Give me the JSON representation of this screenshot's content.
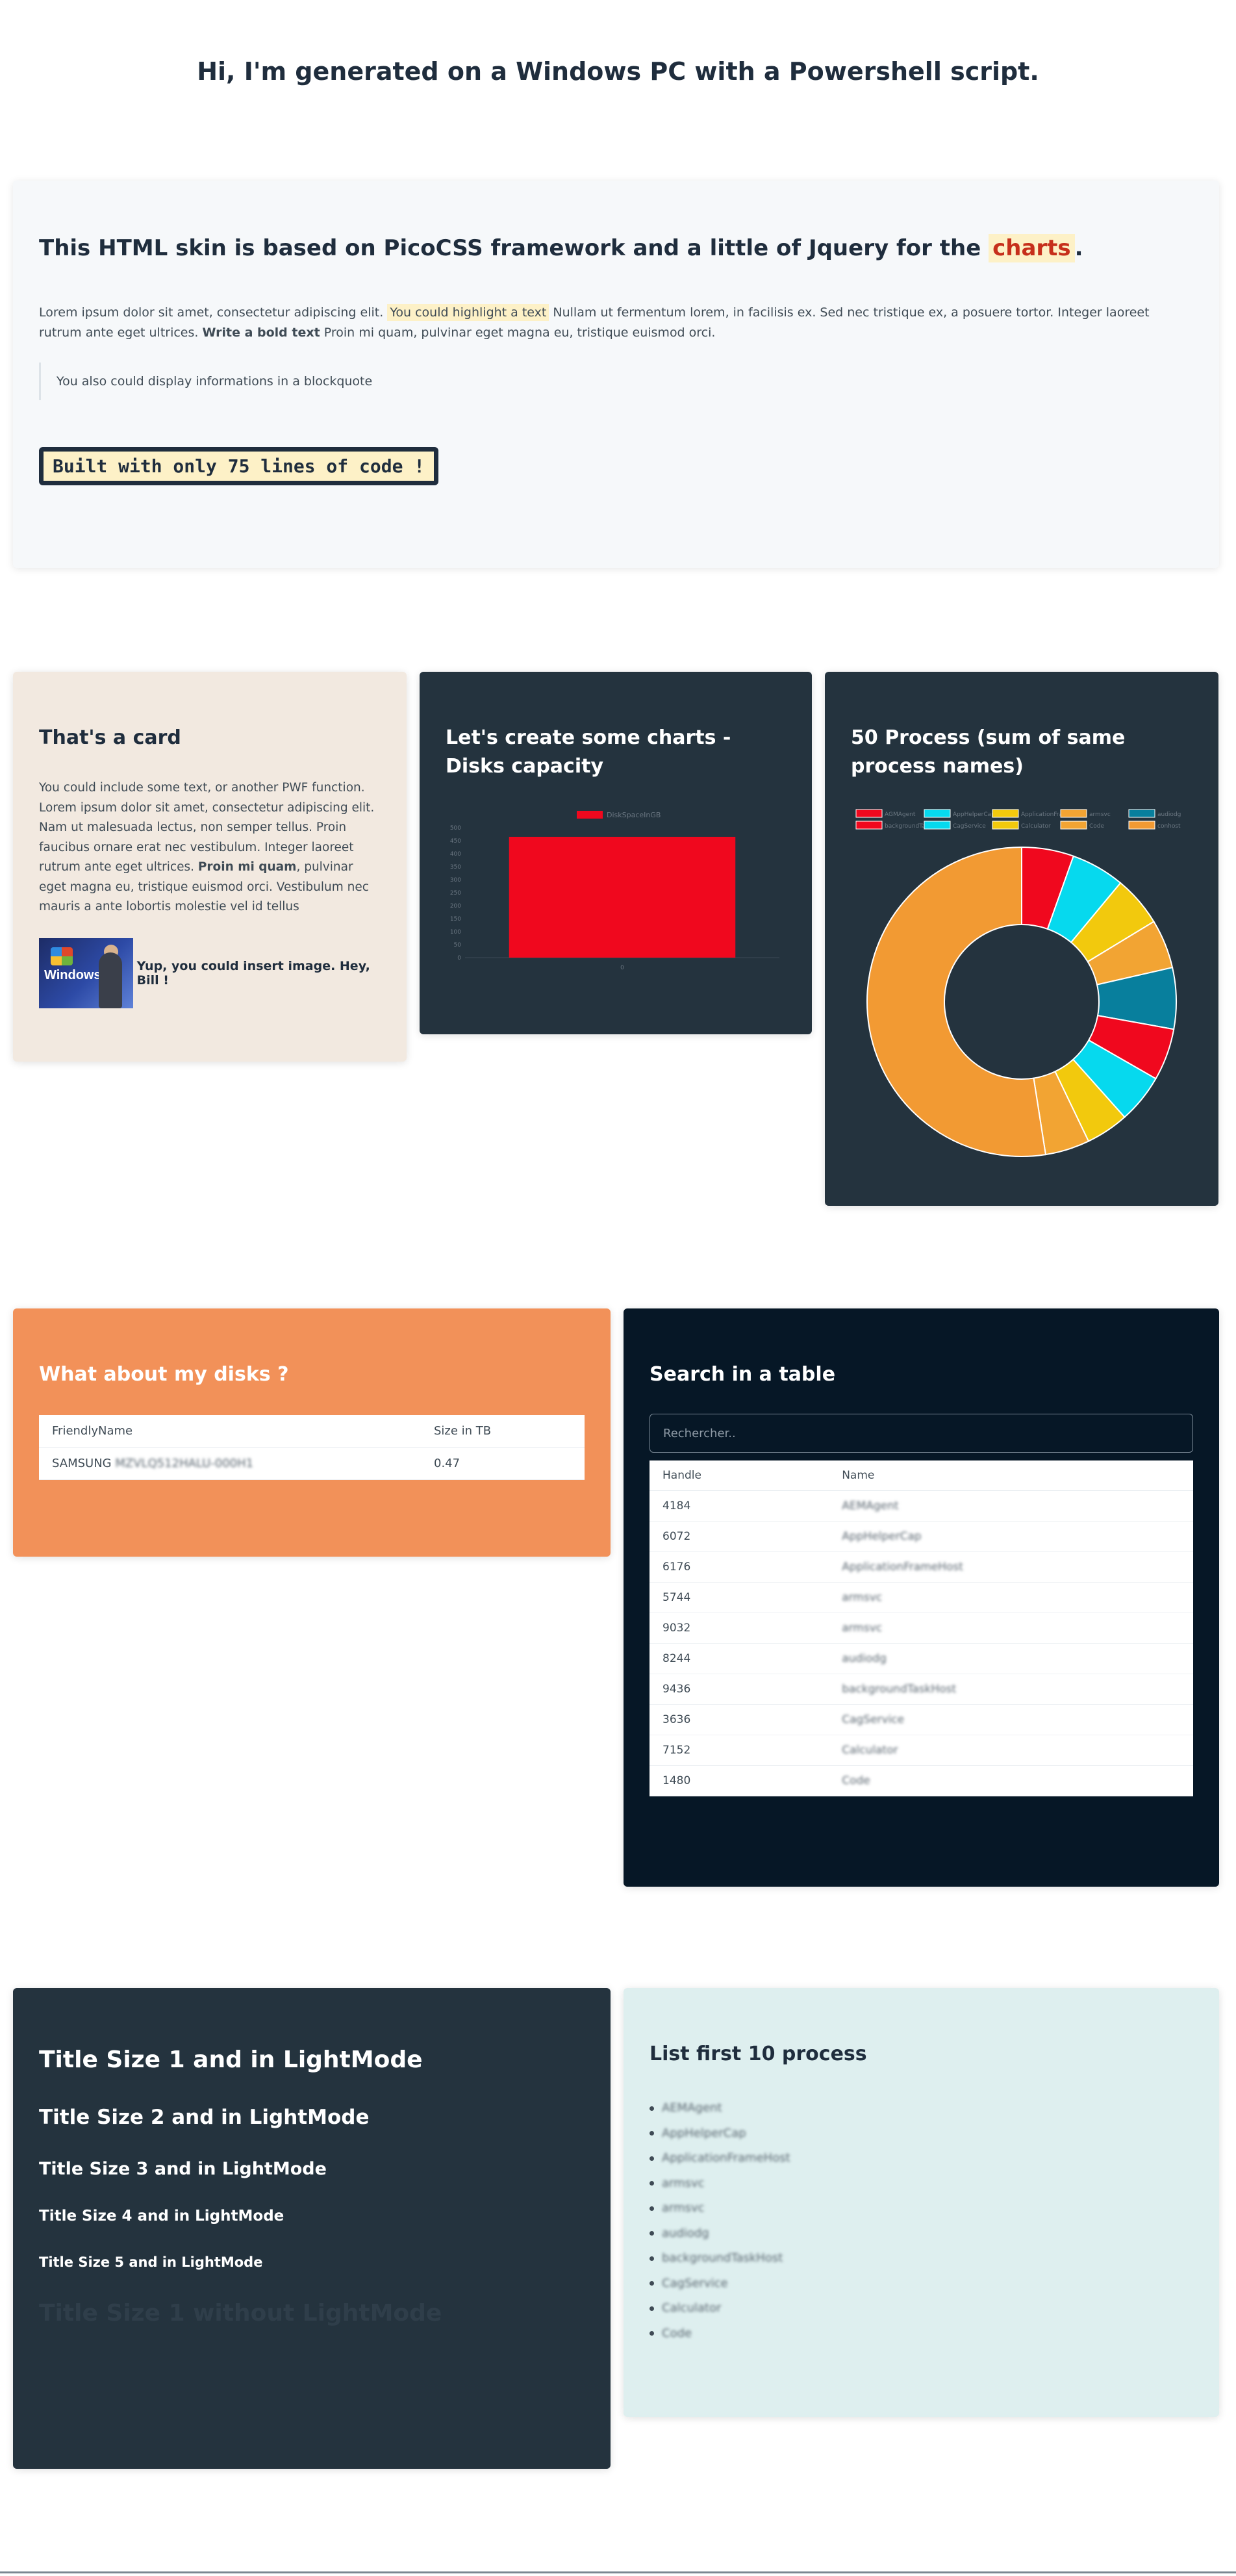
{
  "header": {
    "title": "Hi, I'm generated on a Windows PC with a Powershell script."
  },
  "hero": {
    "title_prefix": "This HTML skin is based on ",
    "title_bold1": "PicoCSS framework",
    "title_mid": " and a ",
    "title_bold2": "little of Jquery",
    "title_for": " for the ",
    "title_hl": "charts",
    "title_end": ".",
    "p_part1": "Lorem ipsum dolor sit amet, consectetur adipiscing elit. ",
    "p_mark": "You could highlight a text",
    "p_part2": " Nullam ut fermentum lorem, in facilisis ex. Sed nec tristique ex, a posuere tortor. Integer laoreet rutrum ante eget ultrices. ",
    "p_bold": "Write a bold text",
    "p_part3": " Proin mi quam, pulvinar eget magna eu, tristique euismod orci.",
    "blockquote": "You also could display informations in a blockquote",
    "code": "Built with only 75 lines of code !"
  },
  "card_info": {
    "title": "That's a card",
    "text1": "You could include some text, or another PWF function. Lorem ipsum dolor sit amet, consectetur adipiscing elit. Nam ut malesuada lectus, non semper tellus. Proin faucibus ornare erat nec vestibulum. Integer laoreet rutrum ante eget ultrices. ",
    "text_bold": "Proin mi quam",
    "text2": ", pulvinar eget magna eu, tristique euismod orci. Vestibulum nec mauris a ante lobortis molestie vel id tellus",
    "image_label": "Windows",
    "image_caption": "Yup, you could insert image. Hey, Bill !"
  },
  "card_disks_chart": {
    "title": "Let's create some charts - Disks capacity"
  },
  "card_process_chart": {
    "title": "50 Process (sum of same process names)"
  },
  "chart_data": [
    {
      "type": "bar",
      "title": "",
      "legend": [
        "DiskSpaceInGB"
      ],
      "categories": [
        "0"
      ],
      "values": [
        465
      ],
      "ylim": [
        0,
        500
      ],
      "yticks": [
        0,
        50,
        100,
        150,
        200,
        250,
        300,
        350,
        400,
        450,
        500
      ],
      "colors": [
        "#f0081e"
      ],
      "grid": false
    },
    {
      "type": "pie",
      "donut": true,
      "labels": [
        "AGMAgent",
        "AppHelperCap",
        "ApplicationFrameHost",
        "armsvc",
        "audiodg",
        "backgroundTaskHost",
        "CagService",
        "Calculator",
        "Code",
        "conhost"
      ],
      "values": [
        2.72,
        2.8,
        2.64,
        2.56,
        3.2,
        2.72,
        2.56,
        2.24,
        2.32,
        26.24
      ],
      "colors": [
        "#f0081e",
        "#06d9ee",
        "#f2c90d",
        "#f2a433",
        "#087f9d",
        "#f0081e",
        "#06d9ee",
        "#f2c90d",
        "#f2a433",
        "#f29a33"
      ],
      "legend_position": "top"
    }
  ],
  "disks_card": {
    "title": "What about my disks ?",
    "columns": [
      "FriendlyName",
      "Size in TB"
    ],
    "rows": [
      {
        "name_visible": "SAMSUNG",
        "name_blur": "MZVLQ512HALU-000H1",
        "size": "0.47"
      }
    ]
  },
  "search_card": {
    "title": "Search in a table",
    "placeholder": "Rechercher..",
    "columns": [
      "Handle",
      "Name"
    ],
    "rows": [
      {
        "handle": "4184",
        "name": "AEMAgent"
      },
      {
        "handle": "6072",
        "name": "AppHelperCap"
      },
      {
        "handle": "6176",
        "name": "ApplicationFrameHost"
      },
      {
        "handle": "5744",
        "name": "armsvc"
      },
      {
        "handle": "9032",
        "name": "armsvc"
      },
      {
        "handle": "8244",
        "name": "audiodg"
      },
      {
        "handle": "9436",
        "name": "backgroundTaskHost"
      },
      {
        "handle": "3636",
        "name": "CagService"
      },
      {
        "handle": "7152",
        "name": "Calculator"
      },
      {
        "handle": "1480",
        "name": "Code"
      }
    ]
  },
  "titles_card": {
    "t1": "Title Size 1 and in LightMode",
    "t2": "Title Size 2 and in LightMode",
    "t3": "Title Size 3 and in LightMode",
    "t4": "Title Size 4 and in LightMode",
    "t5": "Title Size 5 and in LightMode",
    "t6": "Title Size 1 without LightMode"
  },
  "process_list": {
    "title": "List first 10 process",
    "items": [
      "AEMAgent",
      "AppHelperCap",
      "ApplicationFrameHost",
      "armsvc",
      "armsvc",
      "audiodg",
      "backgroundTaskHost",
      "CagService",
      "Calculator",
      "Code"
    ]
  }
}
